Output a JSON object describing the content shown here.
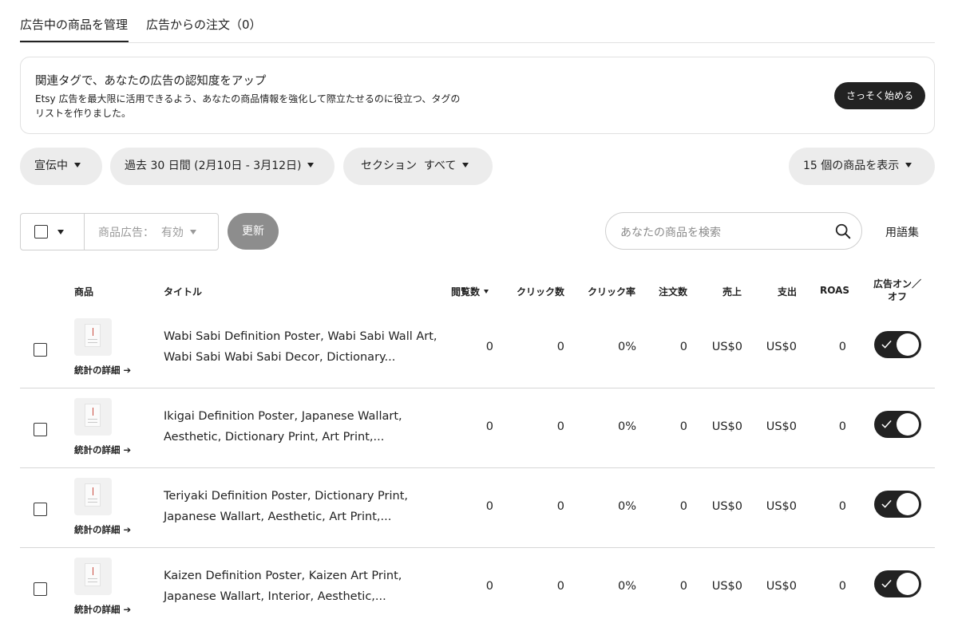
{
  "tabs": {
    "manage_label": "広告中の商品を管理",
    "orders_label": "広告からの注文（0）"
  },
  "banner": {
    "title": "関連タグで、あなたの広告の認知度をアップ",
    "text": "Etsy 広告を最大限に活用できるよう、あなたの商品情報を強化して際立たせるのに役立つ、タグのリストを作りました。",
    "cta_label": "さっそく始める"
  },
  "filters": {
    "status_label": "宣伝中",
    "date_label": "過去 30 日間 (2月10日 - 3月12日)",
    "section_label": "セクション  すべて",
    "display_label": "15 個の商品を表示"
  },
  "toolbar": {
    "bulk_filter_label": "商品広告：  有効",
    "update_label": "更新",
    "search_placeholder": "あなたの商品を検索",
    "glossary_label": "用語集"
  },
  "table": {
    "headers": {
      "product": "商品",
      "title": "タイトル",
      "views": "閲覧数",
      "clicks": "クリック数",
      "ctr": "クリック率",
      "orders": "注文数",
      "revenue": "売上",
      "spend": "支出",
      "roas": "ROAS",
      "onoff_line1": "広告オン／",
      "onoff_line2": "オフ"
    },
    "stats_link_label": "統計の詳細 ➔",
    "rows": [
      {
        "title": "Wabi Sabi Definition Poster, Wabi Sabi Wall Art, Wabi Sabi Wabi Sabi Decor, Dictionary...",
        "views": "0",
        "clicks": "0",
        "ctr": "0%",
        "orders": "0",
        "revenue": "US$0",
        "spend": "US$0",
        "roas": "0",
        "ad_on": true
      },
      {
        "title": "Ikigai Definition Poster, Japanese Wallart, Aesthetic, Dictionary Print, Art Print,...",
        "views": "0",
        "clicks": "0",
        "ctr": "0%",
        "orders": "0",
        "revenue": "US$0",
        "spend": "US$0",
        "roas": "0",
        "ad_on": true
      },
      {
        "title": "Teriyaki Definition Poster, Dictionary Print, Japanese Wallart, Aesthetic, Art Print,...",
        "views": "0",
        "clicks": "0",
        "ctr": "0%",
        "orders": "0",
        "revenue": "US$0",
        "spend": "US$0",
        "roas": "0",
        "ad_on": true
      },
      {
        "title": "Kaizen Definition Poster, Kaizen Art Print, Japanese Wallart, Interior, Aesthetic,...",
        "views": "0",
        "clicks": "0",
        "ctr": "0%",
        "orders": "0",
        "revenue": "US$0",
        "spend": "US$0",
        "roas": "0",
        "ad_on": true
      }
    ]
  },
  "colors": {
    "text": "#222222",
    "button_dark": "#222222",
    "button_disabled": "#8d8d8d",
    "pill_bg": "#ececec",
    "border": "#e1e1e1"
  },
  "icons": {
    "search": "search-icon",
    "caret": "caret-down-icon",
    "check": "check-icon",
    "arrow": "arrow-right-icon"
  }
}
